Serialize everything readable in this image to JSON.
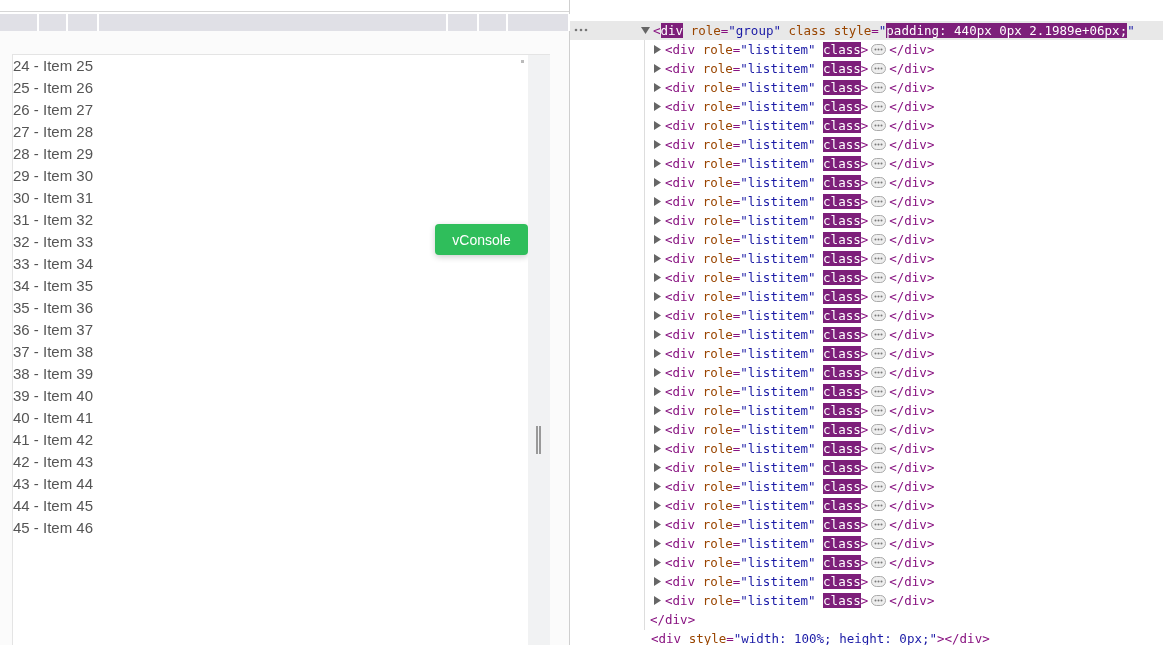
{
  "viewport": {
    "items": [
      "24 - Item 25",
      "25 - Item 26",
      "26 - Item 27",
      "27 - Item 28",
      "28 - Item 29",
      "29 - Item 30",
      "30 - Item 31",
      "31 - Item 32",
      "32 - Item 33",
      "33 - Item 34",
      "34 - Item 35",
      "35 - Item 36",
      "36 - Item 37",
      "37 - Item 38",
      "38 - Item 39",
      "39 - Item 40",
      "40 - Item 41",
      "41 - Item 42",
      "42 - Item 43",
      "43 - Item 44",
      "44 - Item 45",
      "45 - Item 46"
    ],
    "floating_button": "vConsole"
  },
  "elements_panel": {
    "nodes": [
      {
        "expanded": true,
        "selected": true,
        "open": [
          {
            "kind": "punct",
            "text": "<"
          },
          {
            "kind": "tagmark",
            "text": "div"
          },
          {
            "kind": "attr",
            "text": " role"
          },
          {
            "kind": "punct",
            "text": "="
          },
          {
            "kind": "value",
            "text": "\"group\""
          },
          {
            "kind": "attr",
            "text": " class"
          },
          {
            "kind": "attr",
            "text": " style"
          },
          {
            "kind": "punct",
            "text": "="
          },
          {
            "kind": "value",
            "text": "\""
          },
          {
            "kind": "mark",
            "text": "padding: 440px 0px 2.1989e+06px;"
          },
          {
            "kind": "value",
            "text": "\""
          }
        ],
        "children": [
          {
            "expanded": false,
            "selected": false,
            "open": [
              {
                "kind": "punct",
                "text": "<div"
              },
              {
                "kind": "attr",
                "text": " role"
              },
              {
                "kind": "punct",
                "text": "="
              },
              {
                "kind": "value",
                "text": "\"listitem\" "
              },
              {
                "kind": "mark",
                "text": "class"
              },
              {
                "kind": "punct",
                "text": ">"
              }
            ],
            "close": "</div>"
          },
          {
            "expanded": false,
            "selected": false,
            "open": [
              {
                "kind": "punct",
                "text": "<div"
              },
              {
                "kind": "attr",
                "text": " role"
              },
              {
                "kind": "punct",
                "text": "="
              },
              {
                "kind": "value",
                "text": "\"listitem\" "
              },
              {
                "kind": "mark",
                "text": "class"
              },
              {
                "kind": "punct",
                "text": ">"
              }
            ],
            "close": "</div>"
          },
          {
            "expanded": false,
            "selected": false,
            "open": [
              {
                "kind": "punct",
                "text": "<div"
              },
              {
                "kind": "attr",
                "text": " role"
              },
              {
                "kind": "punct",
                "text": "="
              },
              {
                "kind": "value",
                "text": "\"listitem\" "
              },
              {
                "kind": "mark",
                "text": "class"
              },
              {
                "kind": "punct",
                "text": ">"
              }
            ],
            "close": "</div>"
          },
          {
            "expanded": false,
            "selected": false,
            "open": [
              {
                "kind": "punct",
                "text": "<div"
              },
              {
                "kind": "attr",
                "text": " role"
              },
              {
                "kind": "punct",
                "text": "="
              },
              {
                "kind": "value",
                "text": "\"listitem\" "
              },
              {
                "kind": "mark",
                "text": "class"
              },
              {
                "kind": "punct",
                "text": ">"
              }
            ],
            "close": "</div>"
          },
          {
            "expanded": false,
            "selected": false,
            "open": [
              {
                "kind": "punct",
                "text": "<div"
              },
              {
                "kind": "attr",
                "text": " role"
              },
              {
                "kind": "punct",
                "text": "="
              },
              {
                "kind": "value",
                "text": "\"listitem\" "
              },
              {
                "kind": "mark",
                "text": "class"
              },
              {
                "kind": "punct",
                "text": ">"
              }
            ],
            "close": "</div>"
          },
          {
            "expanded": false,
            "selected": false,
            "open": [
              {
                "kind": "punct",
                "text": "<div"
              },
              {
                "kind": "attr",
                "text": " role"
              },
              {
                "kind": "punct",
                "text": "="
              },
              {
                "kind": "value",
                "text": "\"listitem\" "
              },
              {
                "kind": "mark",
                "text": "class"
              },
              {
                "kind": "punct",
                "text": ">"
              }
            ],
            "close": "</div>"
          },
          {
            "expanded": false,
            "selected": false,
            "open": [
              {
                "kind": "punct",
                "text": "<div"
              },
              {
                "kind": "attr",
                "text": " role"
              },
              {
                "kind": "punct",
                "text": "="
              },
              {
                "kind": "value",
                "text": "\"listitem\" "
              },
              {
                "kind": "mark",
                "text": "class"
              },
              {
                "kind": "punct",
                "text": ">"
              }
            ],
            "close": "</div>"
          },
          {
            "expanded": false,
            "selected": false,
            "open": [
              {
                "kind": "punct",
                "text": "<div"
              },
              {
                "kind": "attr",
                "text": " role"
              },
              {
                "kind": "punct",
                "text": "="
              },
              {
                "kind": "value",
                "text": "\"listitem\" "
              },
              {
                "kind": "mark",
                "text": "class"
              },
              {
                "kind": "punct",
                "text": ">"
              }
            ],
            "close": "</div>"
          },
          {
            "expanded": false,
            "selected": false,
            "open": [
              {
                "kind": "punct",
                "text": "<div"
              },
              {
                "kind": "attr",
                "text": " role"
              },
              {
                "kind": "punct",
                "text": "="
              },
              {
                "kind": "value",
                "text": "\"listitem\" "
              },
              {
                "kind": "mark",
                "text": "class"
              },
              {
                "kind": "punct",
                "text": ">"
              }
            ],
            "close": "</div>"
          },
          {
            "expanded": false,
            "selected": false,
            "open": [
              {
                "kind": "punct",
                "text": "<div"
              },
              {
                "kind": "attr",
                "text": " role"
              },
              {
                "kind": "punct",
                "text": "="
              },
              {
                "kind": "value",
                "text": "\"listitem\" "
              },
              {
                "kind": "mark",
                "text": "class"
              },
              {
                "kind": "punct",
                "text": ">"
              }
            ],
            "close": "</div>"
          },
          {
            "expanded": false,
            "selected": false,
            "open": [
              {
                "kind": "punct",
                "text": "<div"
              },
              {
                "kind": "attr",
                "text": " role"
              },
              {
                "kind": "punct",
                "text": "="
              },
              {
                "kind": "value",
                "text": "\"listitem\" "
              },
              {
                "kind": "mark",
                "text": "class"
              },
              {
                "kind": "punct",
                "text": ">"
              }
            ],
            "close": "</div>"
          },
          {
            "expanded": false,
            "selected": false,
            "open": [
              {
                "kind": "punct",
                "text": "<div"
              },
              {
                "kind": "attr",
                "text": " role"
              },
              {
                "kind": "punct",
                "text": "="
              },
              {
                "kind": "value",
                "text": "\"listitem\" "
              },
              {
                "kind": "mark",
                "text": "class"
              },
              {
                "kind": "punct",
                "text": ">"
              }
            ],
            "close": "</div>"
          },
          {
            "expanded": false,
            "selected": false,
            "open": [
              {
                "kind": "punct",
                "text": "<div"
              },
              {
                "kind": "attr",
                "text": " role"
              },
              {
                "kind": "punct",
                "text": "="
              },
              {
                "kind": "value",
                "text": "\"listitem\" "
              },
              {
                "kind": "mark",
                "text": "class"
              },
              {
                "kind": "punct",
                "text": ">"
              }
            ],
            "close": "</div>"
          },
          {
            "expanded": false,
            "selected": false,
            "open": [
              {
                "kind": "punct",
                "text": "<div"
              },
              {
                "kind": "attr",
                "text": " role"
              },
              {
                "kind": "punct",
                "text": "="
              },
              {
                "kind": "value",
                "text": "\"listitem\" "
              },
              {
                "kind": "mark",
                "text": "class"
              },
              {
                "kind": "punct",
                "text": ">"
              }
            ],
            "close": "</div>"
          },
          {
            "expanded": false,
            "selected": false,
            "open": [
              {
                "kind": "punct",
                "text": "<div"
              },
              {
                "kind": "attr",
                "text": " role"
              },
              {
                "kind": "punct",
                "text": "="
              },
              {
                "kind": "value",
                "text": "\"listitem\" "
              },
              {
                "kind": "mark",
                "text": "class"
              },
              {
                "kind": "punct",
                "text": ">"
              }
            ],
            "close": "</div>"
          },
          {
            "expanded": false,
            "selected": false,
            "open": [
              {
                "kind": "punct",
                "text": "<div"
              },
              {
                "kind": "attr",
                "text": " role"
              },
              {
                "kind": "punct",
                "text": "="
              },
              {
                "kind": "value",
                "text": "\"listitem\" "
              },
              {
                "kind": "mark",
                "text": "class"
              },
              {
                "kind": "punct",
                "text": ">"
              }
            ],
            "close": "</div>"
          },
          {
            "expanded": false,
            "selected": false,
            "open": [
              {
                "kind": "punct",
                "text": "<div"
              },
              {
                "kind": "attr",
                "text": " role"
              },
              {
                "kind": "punct",
                "text": "="
              },
              {
                "kind": "value",
                "text": "\"listitem\" "
              },
              {
                "kind": "mark",
                "text": "class"
              },
              {
                "kind": "punct",
                "text": ">"
              }
            ],
            "close": "</div>"
          },
          {
            "expanded": false,
            "selected": false,
            "open": [
              {
                "kind": "punct",
                "text": "<div"
              },
              {
                "kind": "attr",
                "text": " role"
              },
              {
                "kind": "punct",
                "text": "="
              },
              {
                "kind": "value",
                "text": "\"listitem\" "
              },
              {
                "kind": "mark",
                "text": "class"
              },
              {
                "kind": "punct",
                "text": ">"
              }
            ],
            "close": "</div>"
          },
          {
            "expanded": false,
            "selected": false,
            "open": [
              {
                "kind": "punct",
                "text": "<div"
              },
              {
                "kind": "attr",
                "text": " role"
              },
              {
                "kind": "punct",
                "text": "="
              },
              {
                "kind": "value",
                "text": "\"listitem\" "
              },
              {
                "kind": "mark",
                "text": "class"
              },
              {
                "kind": "punct",
                "text": ">"
              }
            ],
            "close": "</div>"
          },
          {
            "expanded": false,
            "selected": false,
            "open": [
              {
                "kind": "punct",
                "text": "<div"
              },
              {
                "kind": "attr",
                "text": " role"
              },
              {
                "kind": "punct",
                "text": "="
              },
              {
                "kind": "value",
                "text": "\"listitem\" "
              },
              {
                "kind": "mark",
                "text": "class"
              },
              {
                "kind": "punct",
                "text": ">"
              }
            ],
            "close": "</div>"
          },
          {
            "expanded": false,
            "selected": false,
            "open": [
              {
                "kind": "punct",
                "text": "<div"
              },
              {
                "kind": "attr",
                "text": " role"
              },
              {
                "kind": "punct",
                "text": "="
              },
              {
                "kind": "value",
                "text": "\"listitem\" "
              },
              {
                "kind": "mark",
                "text": "class"
              },
              {
                "kind": "punct",
                "text": ">"
              }
            ],
            "close": "</div>"
          },
          {
            "expanded": false,
            "selected": false,
            "open": [
              {
                "kind": "punct",
                "text": "<div"
              },
              {
                "kind": "attr",
                "text": " role"
              },
              {
                "kind": "punct",
                "text": "="
              },
              {
                "kind": "value",
                "text": "\"listitem\" "
              },
              {
                "kind": "mark",
                "text": "class"
              },
              {
                "kind": "punct",
                "text": ">"
              }
            ],
            "close": "</div>"
          },
          {
            "expanded": false,
            "selected": false,
            "open": [
              {
                "kind": "punct",
                "text": "<div"
              },
              {
                "kind": "attr",
                "text": " role"
              },
              {
                "kind": "punct",
                "text": "="
              },
              {
                "kind": "value",
                "text": "\"listitem\" "
              },
              {
                "kind": "mark",
                "text": "class"
              },
              {
                "kind": "punct",
                "text": ">"
              }
            ],
            "close": "</div>"
          },
          {
            "expanded": false,
            "selected": false,
            "open": [
              {
                "kind": "punct",
                "text": "<div"
              },
              {
                "kind": "attr",
                "text": " role"
              },
              {
                "kind": "punct",
                "text": "="
              },
              {
                "kind": "value",
                "text": "\"listitem\" "
              },
              {
                "kind": "mark",
                "text": "class"
              },
              {
                "kind": "punct",
                "text": ">"
              }
            ],
            "close": "</div>"
          },
          {
            "expanded": false,
            "selected": false,
            "open": [
              {
                "kind": "punct",
                "text": "<div"
              },
              {
                "kind": "attr",
                "text": " role"
              },
              {
                "kind": "punct",
                "text": "="
              },
              {
                "kind": "value",
                "text": "\"listitem\" "
              },
              {
                "kind": "mark",
                "text": "class"
              },
              {
                "kind": "punct",
                "text": ">"
              }
            ],
            "close": "</div>"
          },
          {
            "expanded": false,
            "selected": false,
            "open": [
              {
                "kind": "punct",
                "text": "<div"
              },
              {
                "kind": "attr",
                "text": " role"
              },
              {
                "kind": "punct",
                "text": "="
              },
              {
                "kind": "value",
                "text": "\"listitem\" "
              },
              {
                "kind": "mark",
                "text": "class"
              },
              {
                "kind": "punct",
                "text": ">"
              }
            ],
            "close": "</div>"
          },
          {
            "expanded": false,
            "selected": false,
            "open": [
              {
                "kind": "punct",
                "text": "<div"
              },
              {
                "kind": "attr",
                "text": " role"
              },
              {
                "kind": "punct",
                "text": "="
              },
              {
                "kind": "value",
                "text": "\"listitem\" "
              },
              {
                "kind": "mark",
                "text": "class"
              },
              {
                "kind": "punct",
                "text": ">"
              }
            ],
            "close": "</div>"
          },
          {
            "expanded": false,
            "selected": false,
            "open": [
              {
                "kind": "punct",
                "text": "<div"
              },
              {
                "kind": "attr",
                "text": " role"
              },
              {
                "kind": "punct",
                "text": "="
              },
              {
                "kind": "value",
                "text": "\"listitem\" "
              },
              {
                "kind": "mark",
                "text": "class"
              },
              {
                "kind": "punct",
                "text": ">"
              }
            ],
            "close": "</div>"
          },
          {
            "expanded": false,
            "selected": false,
            "open": [
              {
                "kind": "punct",
                "text": "<div"
              },
              {
                "kind": "attr",
                "text": " role"
              },
              {
                "kind": "punct",
                "text": "="
              },
              {
                "kind": "value",
                "text": "\"listitem\" "
              },
              {
                "kind": "mark",
                "text": "class"
              },
              {
                "kind": "punct",
                "text": ">"
              }
            ],
            "close": "</div>"
          },
          {
            "expanded": false,
            "selected": false,
            "open": [
              {
                "kind": "punct",
                "text": "<div"
              },
              {
                "kind": "attr",
                "text": " role"
              },
              {
                "kind": "punct",
                "text": "="
              },
              {
                "kind": "value",
                "text": "\"listitem\" "
              },
              {
                "kind": "mark",
                "text": "class"
              },
              {
                "kind": "punct",
                "text": ">"
              }
            ],
            "close": "</div>"
          }
        ],
        "close": "</div>"
      },
      {
        "selected": false,
        "open": [
          {
            "kind": "punct",
            "text": "<div"
          },
          {
            "kind": "attr",
            "text": " style"
          },
          {
            "kind": "punct",
            "text": "="
          },
          {
            "kind": "value",
            "text": "\"width: 100%; height: 0px;\""
          },
          {
            "kind": "punct",
            "text": "></div>"
          }
        ]
      }
    ]
  }
}
